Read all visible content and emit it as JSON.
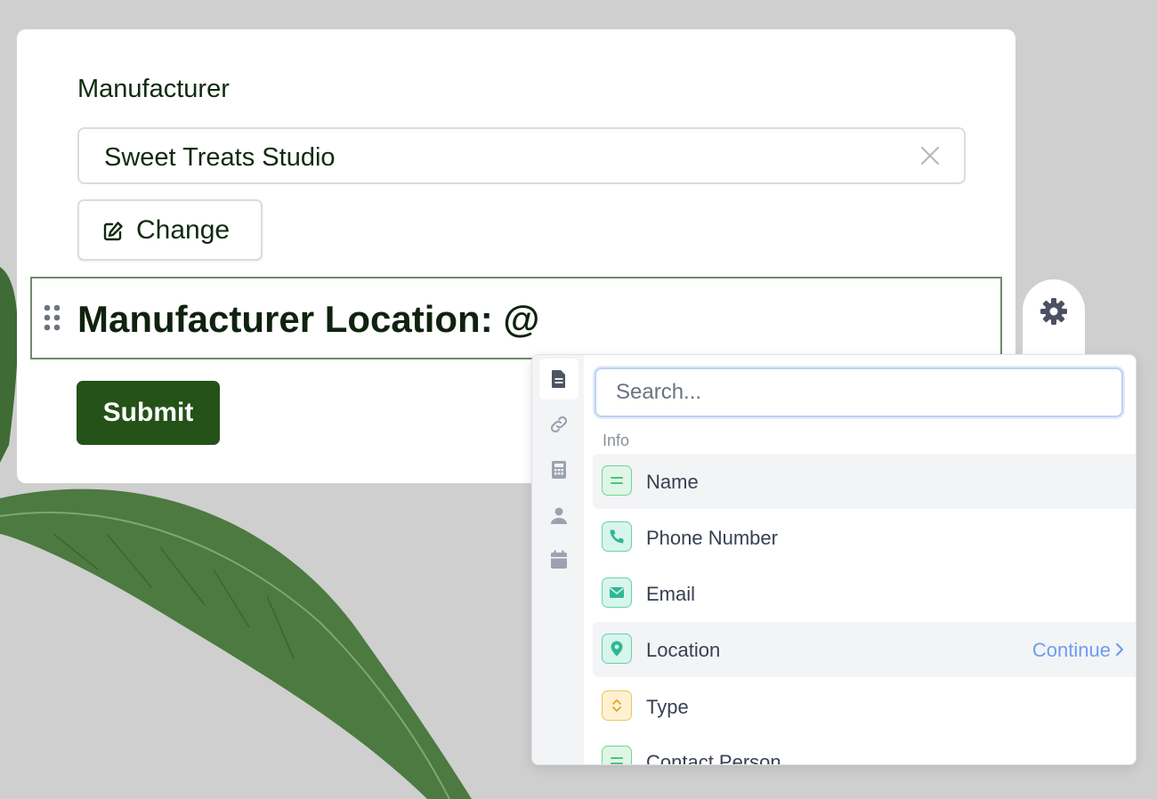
{
  "form": {
    "manufacturer_label": "Manufacturer",
    "manufacturer_value": "Sweet Treats Studio",
    "change_label": "Change",
    "editor_text": "Manufacturer Location: @",
    "submit_label": "Submit"
  },
  "picker": {
    "search_placeholder": "Search...",
    "section_label": "Info",
    "rail_tabs": [
      "document-icon",
      "link-icon",
      "calculator-icon",
      "person-icon",
      "calendar-icon"
    ],
    "items": [
      {
        "label": "Name",
        "icon": "text-lines-icon",
        "color": "#6fd694",
        "highlighted": true
      },
      {
        "label": "Phone Number",
        "icon": "phone-icon",
        "color": "#63d2b0"
      },
      {
        "label": "Email",
        "icon": "envelope-icon",
        "color": "#63d2b0"
      },
      {
        "label": "Location",
        "icon": "map-pin-icon",
        "color": "#63d2b0",
        "highlighted": true,
        "action": "Continue"
      },
      {
        "label": "Type",
        "icon": "select-icon",
        "color": "#f0c160"
      },
      {
        "label": "Contact Person",
        "icon": "text-lines-icon",
        "color": "#6fd694"
      }
    ]
  },
  "colors": {
    "brand_green": "#245218",
    "focus_border": "#6e8a6a",
    "link_blue": "#6c9ef0"
  }
}
